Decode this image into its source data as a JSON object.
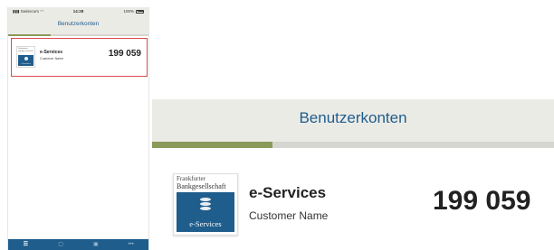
{
  "status_bar": {
    "carrier": "Swisscom",
    "time": "14:28",
    "battery": "100%"
  },
  "header": {
    "title": "Benutzerkonten"
  },
  "progress": {
    "fraction": 0.3
  },
  "account": {
    "logo": {
      "bank_name_line1": "Frankfurter",
      "bank_name_line2": "Bankgesellschaft",
      "product_label": "e-Services"
    },
    "service": "e-Services",
    "customer": "Customer Name",
    "number": "199 059"
  },
  "tab_bar": {
    "tabs": [
      {
        "icon": "list-icon",
        "glyph": "☰",
        "active": true
      },
      {
        "icon": "document-icon",
        "glyph": "▢",
        "active": false
      },
      {
        "icon": "grid-icon",
        "glyph": "▣",
        "active": false
      },
      {
        "icon": "more-icon",
        "glyph": "•••",
        "active": false
      }
    ]
  },
  "colors": {
    "brand_blue": "#1f5d8c",
    "header_bg": "#ebebe6",
    "progress_fill": "#8a9a5b",
    "selection_border": "#d94a4e"
  }
}
